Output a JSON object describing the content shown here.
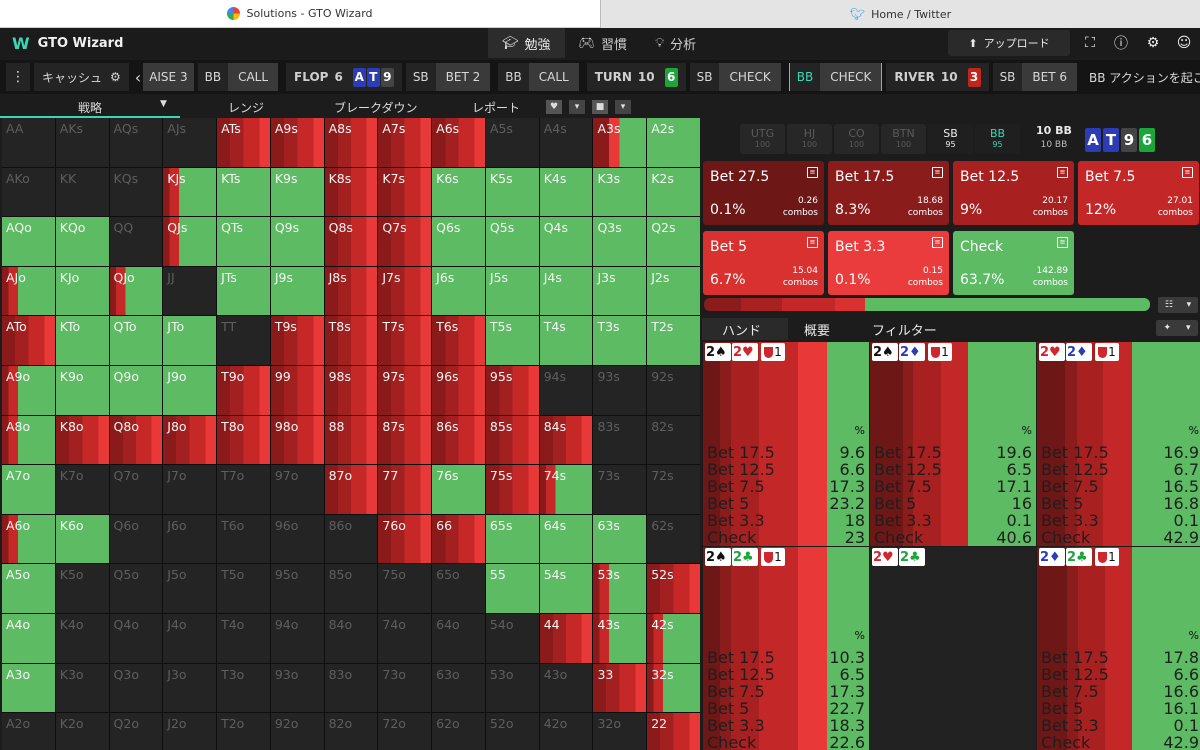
{
  "browser_tabs": [
    {
      "title": "Solutions - GTO Wizard",
      "icon": "google-icon"
    },
    {
      "title": "Home / Twitter",
      "icon": "twitter-icon"
    }
  ],
  "app": {
    "logo": "W",
    "title": "GTO Wizard"
  },
  "nav": [
    {
      "label": "勉強",
      "icon": "graduation-cap-icon",
      "active": true
    },
    {
      "label": "習慣",
      "icon": "gamepad-icon"
    },
    {
      "label": "分析",
      "icon": "lightbulb-icon"
    }
  ],
  "header_right": {
    "upload_label": "アップロード",
    "icons": [
      "screenshot-icon",
      "help-icon",
      "settings-icon",
      "account-icon"
    ]
  },
  "action_bar": {
    "menu_icon": "menu-dots-icon",
    "preset": "キャッシュ",
    "preset_icon": "gear-icon",
    "back_icon": "chevron-left-icon",
    "items": [
      {
        "kind": "action",
        "label": "AISE 3"
      },
      {
        "kind": "pair",
        "pos": "BB",
        "action": "CALL"
      },
      {
        "kind": "street",
        "label": "FLOP",
        "pot": "6",
        "cards": [
          {
            "r": "A",
            "c": "b"
          },
          {
            "r": "T",
            "c": "b"
          },
          {
            "r": "9",
            "c": "k"
          }
        ]
      },
      {
        "kind": "pair",
        "pos": "SB",
        "action": "BET 2"
      },
      {
        "kind": "pair",
        "pos": "BB",
        "action": "CALL"
      },
      {
        "kind": "street",
        "label": "TURN",
        "pot": "10",
        "cards": [
          {
            "r": "6",
            "c": "g"
          }
        ]
      },
      {
        "kind": "pair",
        "pos": "SB",
        "action": "CHECK"
      },
      {
        "kind": "pair",
        "pos": "BB",
        "action": "CHECK",
        "hl": true
      },
      {
        "kind": "street",
        "label": "RIVER",
        "pot": "10",
        "cards": [
          {
            "r": "3",
            "c": "r"
          }
        ]
      },
      {
        "kind": "pair",
        "pos": "SB",
        "action": "BET 6"
      },
      {
        "kind": "text",
        "label": "BB アクションを起こす"
      }
    ]
  },
  "subtabs": [
    {
      "label": "戦略",
      "dropdown": true
    },
    {
      "label": "レンジ"
    },
    {
      "label": "ブレークダウン"
    },
    {
      "label": "レポート"
    }
  ],
  "subtab_icons": [
    "heart-icon",
    "chevron-down-icon",
    "square-icon",
    "chevron-down-icon"
  ],
  "colors": {
    "green": "#5dbb63",
    "red": "#e83838",
    "dark_red": "#8b1a1a",
    "mid_red": "#c62828",
    "na": "#242424"
  },
  "grid": [
    [
      "AA",
      "AKs",
      "AQs",
      "AJs",
      "ATs",
      "A9s",
      "A8s",
      "A7s",
      "A6s",
      "A5s",
      "A4s",
      "A3s",
      "A2s"
    ],
    [
      "AKo",
      "KK",
      "KQs",
      "KJs",
      "KTs",
      "K9s",
      "K8s",
      "K7s",
      "K6s",
      "K5s",
      "K4s",
      "K3s",
      "K2s"
    ],
    [
      "AQo",
      "KQo",
      "QQ",
      "QJs",
      "QTs",
      "Q9s",
      "Q8s",
      "Q7s",
      "Q6s",
      "Q5s",
      "Q4s",
      "Q3s",
      "Q2s"
    ],
    [
      "AJo",
      "KJo",
      "QJo",
      "JJ",
      "JTs",
      "J9s",
      "J8s",
      "J7s",
      "J6s",
      "J5s",
      "J4s",
      "J3s",
      "J2s"
    ],
    [
      "ATo",
      "KTo",
      "QTo",
      "JTo",
      "TT",
      "T9s",
      "T8s",
      "T7s",
      "T6s",
      "T5s",
      "T4s",
      "T3s",
      "T2s"
    ],
    [
      "A9o",
      "K9o",
      "Q9o",
      "J9o",
      "T9o",
      "99",
      "98s",
      "97s",
      "96s",
      "95s",
      "94s",
      "93s",
      "92s"
    ],
    [
      "A8o",
      "K8o",
      "Q8o",
      "J8o",
      "T8o",
      "98o",
      "88",
      "87s",
      "86s",
      "85s",
      "84s",
      "83s",
      "82s"
    ],
    [
      "A7o",
      "K7o",
      "Q7o",
      "J7o",
      "T7o",
      "97o",
      "87o",
      "77",
      "76s",
      "75s",
      "74s",
      "73s",
      "72s"
    ],
    [
      "A6o",
      "K6o",
      "Q6o",
      "J6o",
      "T6o",
      "96o",
      "86o",
      "76o",
      "66",
      "65s",
      "64s",
      "63s",
      "62s"
    ],
    [
      "A5o",
      "K5o",
      "Q5o",
      "J5o",
      "T5o",
      "95o",
      "85o",
      "75o",
      "65o",
      "55",
      "54s",
      "53s",
      "52s"
    ],
    [
      "A4o",
      "K4o",
      "Q4o",
      "J4o",
      "T4o",
      "94o",
      "84o",
      "74o",
      "64o",
      "54o",
      "44",
      "43s",
      "42s"
    ],
    [
      "A3o",
      "K3o",
      "Q3o",
      "J3o",
      "T3o",
      "93o",
      "83o",
      "73o",
      "63o",
      "53o",
      "43o",
      "33",
      "32s"
    ],
    [
      "A2o",
      "K2o",
      "Q2o",
      "J2o",
      "T2o",
      "92o",
      "82o",
      "72o",
      "62o",
      "52o",
      "42o",
      "32o",
      "22"
    ]
  ],
  "grid_mix": [
    [
      "n",
      "n",
      "n",
      "n",
      "r",
      "r",
      "r",
      "r",
      "r",
      "n",
      "n",
      "gr",
      "g"
    ],
    [
      "n",
      "n",
      "n",
      "rg",
      "g",
      "g",
      "r",
      "r",
      "g",
      "g",
      "g",
      "g",
      "g"
    ],
    [
      "g",
      "g",
      "n",
      "rg",
      "g",
      "g",
      "r",
      "r",
      "g",
      "g",
      "g",
      "g",
      "g"
    ],
    [
      "rg",
      "g",
      "rg",
      "n",
      "g",
      "g",
      "r",
      "r",
      "g",
      "g",
      "g",
      "g",
      "g"
    ],
    [
      "r",
      "g",
      "g",
      "g",
      "n",
      "r",
      "r",
      "r",
      "r",
      "g",
      "g",
      "g",
      "g"
    ],
    [
      "rg",
      "g",
      "g",
      "g",
      "r",
      "r",
      "r",
      "r",
      "r",
      "r",
      "n",
      "n",
      "n"
    ],
    [
      "rg",
      "r",
      "r",
      "r",
      "r",
      "r",
      "r",
      "r",
      "r",
      "r",
      "r",
      "n",
      "n"
    ],
    [
      "g",
      "n",
      "n",
      "n",
      "n",
      "n",
      "r",
      "r",
      "g",
      "r",
      "rg",
      "n",
      "n"
    ],
    [
      "rg",
      "g",
      "n",
      "n",
      "n",
      "n",
      "n",
      "r",
      "r",
      "g",
      "g",
      "g",
      "n"
    ],
    [
      "g",
      "n",
      "n",
      "n",
      "n",
      "n",
      "n",
      "n",
      "n",
      "g",
      "g",
      "rg",
      "r"
    ],
    [
      "g",
      "n",
      "n",
      "n",
      "n",
      "n",
      "n",
      "n",
      "n",
      "n",
      "r",
      "rg",
      "rg"
    ],
    [
      "g",
      "n",
      "n",
      "n",
      "n",
      "n",
      "n",
      "n",
      "n",
      "n",
      "n",
      "r",
      "rg"
    ],
    [
      "n",
      "n",
      "n",
      "n",
      "n",
      "n",
      "n",
      "n",
      "n",
      "n",
      "n",
      "n",
      "r"
    ]
  ],
  "positions": [
    {
      "name": "UTG",
      "stack": "100"
    },
    {
      "name": "HJ",
      "stack": "100"
    },
    {
      "name": "CO",
      "stack": "100"
    },
    {
      "name": "BTN",
      "stack": "100"
    },
    {
      "name": "SB",
      "stack": "95",
      "on": true
    },
    {
      "name": "BB",
      "stack": "95",
      "on": true,
      "bb": true
    }
  ],
  "pot": {
    "top": "10 BB",
    "bottom": "10 BB"
  },
  "board": [
    {
      "r": "A",
      "c": "b"
    },
    {
      "r": "T",
      "c": "b"
    },
    {
      "r": "9",
      "c": "k"
    },
    {
      "r": "6",
      "c": "g"
    }
  ],
  "actions": [
    {
      "name": "Bet 27.5",
      "pct": "0.1%",
      "combos": "0.26",
      "label": "combos",
      "color": "#6e1717"
    },
    {
      "name": "Bet 17.5",
      "pct": "8.3%",
      "combos": "18.68",
      "label": "combos",
      "color": "#8a1c1c"
    },
    {
      "name": "Bet 12.5",
      "pct": "9%",
      "combos": "20.17",
      "label": "combos",
      "color": "#a82020"
    },
    {
      "name": "Bet 7.5",
      "pct": "12%",
      "combos": "27.01",
      "label": "combos",
      "color": "#c42727"
    },
    {
      "name": "Bet 5",
      "pct": "6.7%",
      "combos": "15.04",
      "label": "combos",
      "color": "#d93030"
    },
    {
      "name": "Bet 3.3",
      "pct": "0.1%",
      "combos": "0.15",
      "label": "combos",
      "color": "#ea3c3c"
    },
    {
      "name": "Check",
      "pct": "63.7%",
      "combos": "142.89",
      "label": "combos",
      "color": "#5dbb63"
    }
  ],
  "freq_icons": [
    "grid-icon",
    "chevron-down-icon"
  ],
  "right_tabs": [
    {
      "label": "ハンド",
      "active": true
    },
    {
      "label": "概要"
    },
    {
      "label": "フィルター"
    }
  ],
  "right_tab_icons": [
    "pin-icon",
    "chevron-down-icon"
  ],
  "combos": [
    {
      "cards": [
        {
          "t": "2♠",
          "c": "#111"
        },
        {
          "t": "2♥",
          "c": "#d0262e"
        }
      ],
      "badge": "1",
      "pct_label": "%",
      "rows": [
        [
          "Bet 17.5",
          "9.6"
        ],
        [
          "Bet 12.5",
          "6.6"
        ],
        [
          "Bet 7.5",
          "17.3"
        ],
        [
          "Bet 5",
          "23.2"
        ],
        [
          "Bet 3.3",
          "18"
        ],
        [
          "Check",
          "23"
        ]
      ],
      "mix": [
        0.1,
        0.07,
        0.17,
        0.23,
        0.18,
        0.25
      ]
    },
    {
      "cards": [
        {
          "t": "2♠",
          "c": "#111"
        },
        {
          "t": "2♦",
          "c": "#2b3cb5"
        }
      ],
      "badge": "1",
      "pct_label": "%",
      "rows": [
        [
          "Bet 17.5",
          "19.6"
        ],
        [
          "Bet 12.5",
          "6.5"
        ],
        [
          "Bet 7.5",
          "17.1"
        ],
        [
          "Bet 5",
          "16"
        ],
        [
          "Bet 3.3",
          "0.1"
        ],
        [
          "Check",
          "40.6"
        ]
      ],
      "mix": [
        0.2,
        0.06,
        0.17,
        0.16,
        0.0,
        0.41
      ]
    },
    {
      "cards": [
        {
          "t": "2♥",
          "c": "#d0262e"
        },
        {
          "t": "2♦",
          "c": "#2b3cb5"
        }
      ],
      "badge": "1",
      "pct_label": "%",
      "rows": [
        [
          "Bet 17.5",
          "16.9"
        ],
        [
          "Bet 12.5",
          "6.7"
        ],
        [
          "Bet 7.5",
          "16.5"
        ],
        [
          "Bet 5",
          "16.8"
        ],
        [
          "Bet 3.3",
          "0.1"
        ],
        [
          "Check",
          "42.9"
        ]
      ],
      "mix": [
        0.17,
        0.07,
        0.16,
        0.17,
        0.0,
        0.43
      ]
    },
    {
      "cards": [
        {
          "t": "2♠",
          "c": "#111"
        },
        {
          "t": "2♣",
          "c": "#1ca53a"
        }
      ],
      "badge": "1",
      "pct_label": "%",
      "rows": [
        [
          "Bet 17.5",
          "10.3"
        ],
        [
          "Bet 12.5",
          "6.5"
        ],
        [
          "Bet 7.5",
          "17.3"
        ],
        [
          "Bet 5",
          "22.7"
        ],
        [
          "Bet 3.3",
          "18.3"
        ],
        [
          "Check",
          "22.6"
        ]
      ],
      "mix": [
        0.1,
        0.07,
        0.17,
        0.23,
        0.18,
        0.25
      ]
    },
    {
      "cards": [
        {
          "t": "2♥",
          "c": "#d0262e"
        },
        {
          "t": "2♣",
          "c": "#1ca53a"
        }
      ],
      "badge": "",
      "pct_label": "",
      "rows": [],
      "mix": []
    },
    {
      "cards": [
        {
          "t": "2♦",
          "c": "#2b3cb5"
        },
        {
          "t": "2♣",
          "c": "#1ca53a"
        }
      ],
      "badge": "1",
      "pct_label": "%",
      "rows": [
        [
          "Bet 17.5",
          "17.8"
        ],
        [
          "Bet 12.5",
          "6.6"
        ],
        [
          "Bet 7.5",
          "16.6"
        ],
        [
          "Bet 5",
          "16.1"
        ],
        [
          "Bet 3.3",
          "0.1"
        ],
        [
          "Check",
          "42.9"
        ]
      ],
      "mix": [
        0.18,
        0.07,
        0.16,
        0.16,
        0.0,
        0.43
      ]
    }
  ]
}
